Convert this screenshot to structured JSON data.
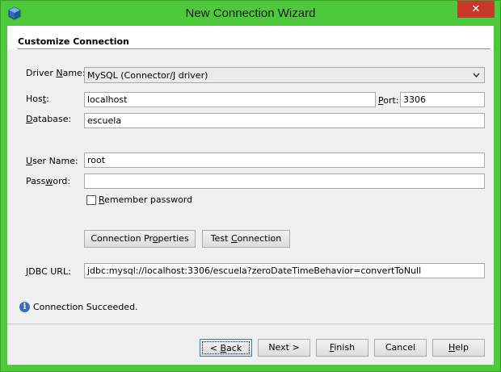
{
  "window": {
    "title": "New Connection Wizard",
    "close_glyph": "✕"
  },
  "header": {
    "title": "Customize Connection"
  },
  "form": {
    "driver_label_pre": "Driver ",
    "driver_label_mnemonic": "N",
    "driver_label_post": "ame:",
    "driver_value": "MySQL (Connector/J driver)",
    "host_label_pre": "Hos",
    "host_label_mnemonic": "t",
    "host_label_post": ":",
    "host_value": "localhost",
    "port_label_mnemonic": "P",
    "port_label_post": "ort:",
    "port_value": "3306",
    "database_label_mnemonic": "D",
    "database_label_post": "atabase:",
    "database_value": "escuela",
    "username_label_mnemonic": "U",
    "username_label_post": "ser Name:",
    "username_value": "root",
    "password_label_pre": "Pass",
    "password_label_mnemonic": "w",
    "password_label_post": "ord:",
    "password_value": "",
    "remember_label_mnemonic": "R",
    "remember_label_post": "emember password",
    "remember_checked": false,
    "jdbc_label_mnemonic": "J",
    "jdbc_label_post": "DBC URL:",
    "jdbc_value": "jdbc:mysql://localhost:3306/escuela?zeroDateTimeBehavior=convertToNull"
  },
  "buttons": {
    "connection_properties_pre": "Connection Pr",
    "connection_properties_mnemonic": "o",
    "connection_properties_post": "perties",
    "test_connection_pre": "Test ",
    "test_connection_mnemonic": "C",
    "test_connection_post": "onnection"
  },
  "status": {
    "message": "Connection Succeeded.",
    "icon": "info-icon"
  },
  "nav": {
    "back_pre": "< ",
    "back_mnemonic": "B",
    "back_post": "ack",
    "next_label": "Next >",
    "finish_mnemonic": "F",
    "finish_post": "inish",
    "cancel_label": "Cancel",
    "help_mnemonic": "H",
    "help_post": "elp"
  },
  "colors": {
    "frame": "#4dc93b",
    "close": "#c7382b",
    "panel": "#f0f0f0"
  }
}
